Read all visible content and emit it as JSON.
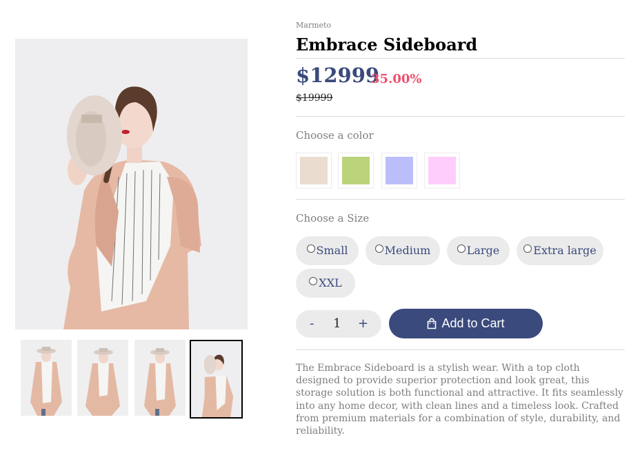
{
  "gallery": {
    "main_image_alt": "",
    "thumbnails": [
      "",
      "",
      "",
      ""
    ],
    "selected_thumbnail": 4
  },
  "product": {
    "vendor": "Marmeto",
    "title": "Embrace Sideboard",
    "price": "$12999",
    "discount": "35.00%",
    "compare_at_price": "$19999",
    "colors": {
      "label": "Choose a color",
      "swatches": [
        "#eaddcf",
        "#bbd37b",
        "#bbbefa",
        "#fecdfb"
      ]
    },
    "sizes": {
      "label": "Choose a Size",
      "options": [
        "Small",
        "Medium",
        "Large",
        "Extra large",
        "XXL"
      ]
    },
    "quantity": {
      "minus": "-",
      "value": "1",
      "plus": "+"
    },
    "add_to_cart": "Add to Cart",
    "description": "The Embrace Sideboard is a stylish wear. With a top cloth designed to provide superior protection and look great, this storage solution is both functional and attractive. It fits seamlessly into any home decor, with clean lines and a timeless look. Crafted from premium materials for a combination of style, durability, and reliability."
  },
  "theme": {
    "accent": "#3a4a7c",
    "discount_color": "#ef4e6e",
    "muted_text": "#7d7d7d",
    "pill_bg": "#ebebeb"
  }
}
